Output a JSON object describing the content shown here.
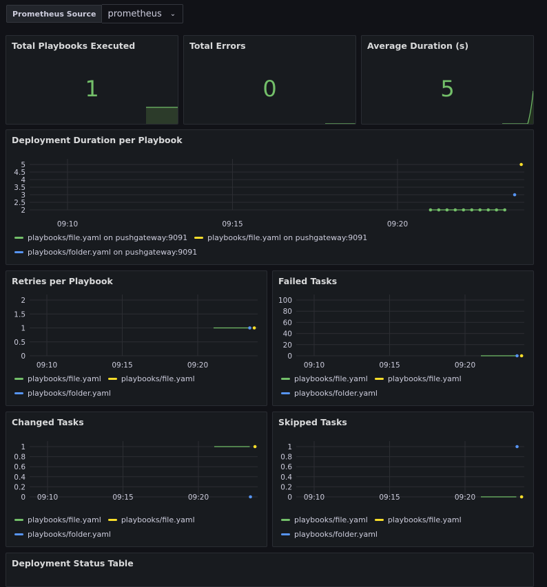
{
  "variable": {
    "label": "Prometheus Source",
    "value": "prometheus"
  },
  "colors": {
    "green": "#73bf69",
    "yellow": "#fade2a",
    "blue": "#5794f2"
  },
  "stats": [
    {
      "title": "Total Playbooks Executed",
      "value": "1"
    },
    {
      "title": "Total Errors",
      "value": "0"
    },
    {
      "title": "Average Duration (s)",
      "value": "5"
    }
  ],
  "deployment": {
    "title": "Deployment Duration per Playbook",
    "legend": [
      "playbooks/file.yaml on pushgateway:9091",
      "playbooks/file.yaml on pushgateway:9091",
      "playbooks/folder.yaml on pushgateway:9091"
    ]
  },
  "retries": {
    "title": "Retries per Playbook"
  },
  "failed": {
    "title": "Failed Tasks"
  },
  "changed": {
    "title": "Changed Tasks"
  },
  "skipped": {
    "title": "Skipped Tasks"
  },
  "short_legend": [
    "playbooks/file.yaml",
    "playbooks/file.yaml",
    "playbooks/folder.yaml"
  ],
  "table": {
    "title": "Deployment Status Table"
  },
  "chart_data": [
    {
      "type": "line",
      "id": "deployment",
      "x_ticks": [
        "09:10",
        "09:15",
        "09:20"
      ],
      "y_ticks": [
        "2",
        "2.5",
        "3",
        "3.5",
        "4",
        "4.5",
        "5"
      ],
      "ylim": [
        2,
        5
      ],
      "xlim": [
        7.5,
        23.9
      ],
      "series": [
        {
          "color": "green",
          "points": [
            [
              21.0,
              2
            ],
            [
              21.5,
              2
            ],
            [
              22.0,
              2
            ],
            [
              22.5,
              2
            ],
            [
              23.0,
              2
            ],
            [
              23.5,
              2
            ],
            [
              24.0,
              2
            ],
            [
              24.5,
              2
            ],
            [
              25.0,
              2
            ],
            [
              25.5,
              2
            ]
          ],
          "scale": "alt"
        },
        {
          "color": "yellow",
          "points": [
            [
              23.75,
              5
            ]
          ]
        },
        {
          "color": "blue",
          "points": [
            [
              23.55,
              3
            ]
          ]
        }
      ]
    },
    {
      "type": "line",
      "id": "retries",
      "x_ticks": [
        "09:10",
        "09:15",
        "09:20"
      ],
      "y_ticks": [
        "0",
        "0.5",
        "1",
        "1.5",
        "2"
      ],
      "ylim": [
        0,
        2
      ],
      "series": [
        {
          "color": "green",
          "points": [
            [
              21.05,
              1
            ],
            [
              23.4,
              1
            ]
          ]
        },
        {
          "color": "blue",
          "points": [
            [
              23.45,
              1
            ]
          ]
        },
        {
          "color": "yellow",
          "points": [
            [
              23.75,
              1
            ]
          ]
        }
      ]
    },
    {
      "type": "line",
      "id": "failed",
      "x_ticks": [
        "09:10",
        "09:15",
        "09:20"
      ],
      "y_ticks": [
        "0",
        "20",
        "40",
        "60",
        "80",
        "100"
      ],
      "ylim": [
        0,
        100
      ],
      "series": [
        {
          "color": "green",
          "points": [
            [
              21.05,
              0
            ],
            [
              23.4,
              0
            ]
          ]
        },
        {
          "color": "blue",
          "points": [
            [
              23.45,
              0
            ]
          ]
        },
        {
          "color": "yellow",
          "points": [
            [
              23.75,
              0
            ]
          ]
        }
      ]
    },
    {
      "type": "line",
      "id": "changed",
      "x_ticks": [
        "09:10",
        "09:15",
        "09:20"
      ],
      "y_ticks": [
        "0",
        "0.2",
        "0.4",
        "0.6",
        "0.8",
        "1"
      ],
      "ylim": [
        0,
        1
      ],
      "series": [
        {
          "color": "green",
          "points": [
            [
              21.05,
              1
            ],
            [
              23.4,
              1
            ]
          ]
        },
        {
          "color": "yellow",
          "points": [
            [
              23.75,
              1
            ]
          ]
        },
        {
          "color": "blue",
          "points": [
            [
              23.45,
              0
            ]
          ]
        }
      ]
    },
    {
      "type": "line",
      "id": "skipped",
      "x_ticks": [
        "09:10",
        "09:15",
        "09:20"
      ],
      "y_ticks": [
        "0",
        "0.2",
        "0.4",
        "0.6",
        "0.8",
        "1"
      ],
      "ylim": [
        0,
        1
      ],
      "series": [
        {
          "color": "green",
          "points": [
            [
              21.05,
              0
            ],
            [
              23.4,
              0
            ]
          ]
        },
        {
          "color": "blue",
          "points": [
            [
              23.45,
              1
            ]
          ]
        },
        {
          "color": "yellow",
          "points": [
            [
              23.75,
              0
            ]
          ]
        }
      ]
    }
  ]
}
